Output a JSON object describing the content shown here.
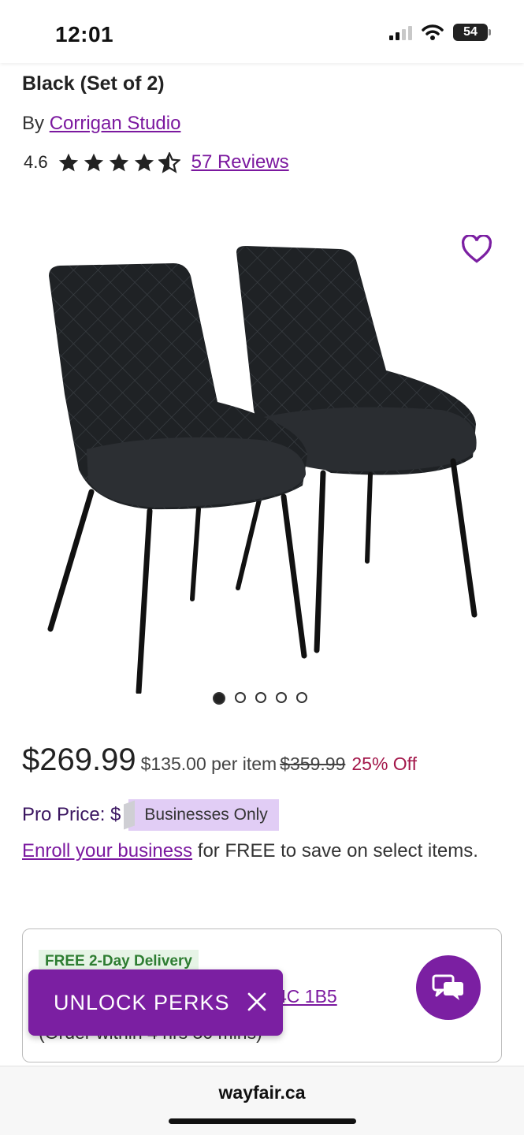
{
  "status": {
    "time": "12:01",
    "battery": "54"
  },
  "product": {
    "title": "Black (Set of 2)",
    "by_label": "By",
    "brand": "Corrigan Studio",
    "rating": "4.6",
    "rating_value": 4.6,
    "reviews_label": "57 Reviews"
  },
  "gallery": {
    "image_count": 5,
    "active_index": 0
  },
  "pricing": {
    "price": "$269.99",
    "per_item": "$135.00 per item",
    "was_price": "$359.99",
    "discount": "25% Off",
    "pro_label": "Pro Price: $",
    "pro_badge": "Businesses Only",
    "enroll_link": "Enroll your business",
    "enroll_text": " for FREE to save on select items."
  },
  "delivery": {
    "badge": "FREE 2-Day Delivery",
    "zip_link": "4C 1B5",
    "order_within": "(Order within 4 hrs 30 mins)"
  },
  "promo": {
    "label": "UNLOCK PERKS"
  },
  "browser": {
    "url": "wayfair.ca"
  },
  "colors": {
    "accent": "#7b1fa2",
    "discount": "#a3174a",
    "delivery_green": "#2e7d32"
  }
}
